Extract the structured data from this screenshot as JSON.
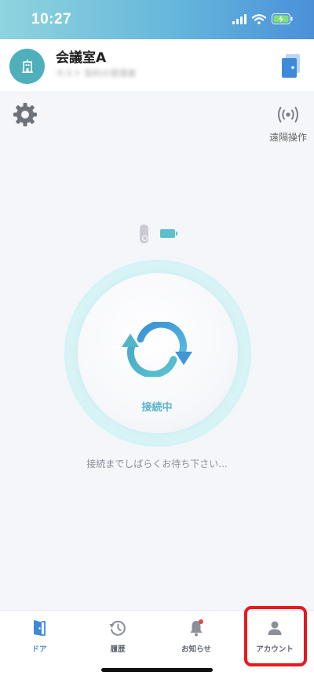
{
  "status_bar": {
    "time": "10:27"
  },
  "header": {
    "room_title": "会議室A",
    "room_subtitle": "ホスト 契約の管理者",
    "avatar_icon": "office-building-icon",
    "switch_icon": "door-switch-icon"
  },
  "controls": {
    "settings_icon": "gear-icon",
    "remote_label": "遠隔操作",
    "remote_icon": "wireless-signal-icon"
  },
  "device": {
    "lock_icon": "smart-lock-icon",
    "battery_icon": "battery-icon"
  },
  "connection": {
    "status_label": "接続中",
    "wait_message": "接続までしばらくお待ち下さい..."
  },
  "tabs": [
    {
      "label": "ドア",
      "icon": "door-icon",
      "active": true
    },
    {
      "label": "履歴",
      "icon": "history-clock-icon",
      "active": false
    },
    {
      "label": "お知らせ",
      "icon": "bell-icon",
      "active": false
    },
    {
      "label": "アカウント",
      "icon": "person-icon",
      "active": false
    }
  ],
  "colors": {
    "accent": "#4a8fd6",
    "teal": "#5bc0c9",
    "highlight": "#e8191f"
  }
}
